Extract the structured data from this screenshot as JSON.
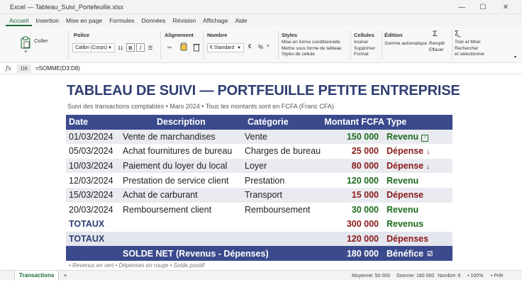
{
  "window": {
    "title": "Excel — Tableau_Suivi_Portefeuille.xlsx",
    "minimize": "—",
    "maximize": "☐",
    "close": "✕"
  },
  "menu": {
    "tabs": [
      "Accueil",
      "Insertion",
      "Mise en page",
      "Formules",
      "Données",
      "Révision",
      "Affichage",
      "Aide"
    ],
    "active_index": 0
  },
  "ribbon": {
    "paste_label": "Coller",
    "font_group": "Police",
    "font_name": "Calibri (Corps)",
    "font_size": "11",
    "bold": "B",
    "italic": "I",
    "underline": "☰",
    "alignment_group": "Alignement",
    "number_group": "Nombre",
    "number_format": "€ Standard",
    "percent": "%",
    "styles_group": "Styles",
    "styles_items": [
      "Mise en forme conditionnelle",
      "Mettre sous forme de tableau",
      "Styles de cellule"
    ],
    "cells_group": "Cellules",
    "cells_items": [
      "Insérer",
      "Supprimer",
      "Format"
    ],
    "editing_group": "Édition",
    "editing_items": [
      "Somme automatique",
      "Remplir",
      "Effacer"
    ],
    "sort_items": [
      "Trier et filtrer",
      "Rechercher",
      "et sélectionner"
    ]
  },
  "formula_bar": {
    "fx": "fx",
    "cell_ref": "D9",
    "formula": "=SOMME(D3:D8)"
  },
  "sheet": {
    "title": "TABLEAU DE SUIVI — PORTFEUILLE PETITE ENTREPRISE",
    "subtitle": "Suivi des transactions comptables • Mars 2024 • Tous les montants sont en FCFA (Franc CFA)",
    "headers": [
      "Date",
      "Description",
      "Catégorie",
      "Montant FCFA",
      "Type"
    ],
    "rows": [
      {
        "date": "01/03/2024",
        "description": "Vente de marchandises",
        "category": "Vente",
        "amount": "150 000",
        "type": "Revenu",
        "kind": "revenue",
        "icon": "↑"
      },
      {
        "date": "05/03/2024",
        "description": "Achat fournitures de bureau",
        "category": "Charges de bureau",
        "amount": "25 000",
        "type": "Dépense",
        "kind": "expense",
        "icon": "↓"
      },
      {
        "date": "10/03/2024",
        "description": "Paiement du loyer du local",
        "category": "Loyer",
        "amount": "80 000",
        "type": "Dépense",
        "kind": "expense",
        "icon": "↓"
      },
      {
        "date": "12/03/2024",
        "description": "Prestation de service client",
        "category": "Prestation",
        "amount": "120 000",
        "type": "Revenu",
        "kind": "revenue",
        "icon": ""
      },
      {
        "date": "15/03/2024",
        "description": "Achat de carburant",
        "category": "Transport",
        "amount": "15 000",
        "type": "Dépense",
        "kind": "expense",
        "icon": ""
      },
      {
        "date": "20/03/2024",
        "description": "Remboursement client",
        "category": "Remboursement",
        "amount": "30 000",
        "type": "Revenu",
        "kind": "revenue",
        "icon": ""
      }
    ],
    "totals": [
      {
        "label": "TOTAUX",
        "amount": "300 000",
        "type": "Revenus",
        "kind": "revenue"
      },
      {
        "label": "TOTAUX",
        "amount": "120 000",
        "type": "Dépenses",
        "kind": "expense"
      }
    ],
    "net": {
      "label": "SOLDE NET (Revenus - Dépenses)",
      "amount": "180 000",
      "type": "Bénéfice",
      "icon": "☑"
    },
    "note": "• Revenus en vert • Dépenses en rouge • Solde positif"
  },
  "status": {
    "sheet_tab": "Transactions",
    "add_tab": "+",
    "average": "Moyenne: 50 000",
    "sum": "Somme: 180 000",
    "count": "Nombre: 6",
    "zoom": "• 100%",
    "ready": "• Prêt"
  },
  "colors": {
    "header_bg": "#3a4a8c",
    "title": "#2f3e73",
    "revenue": "#1e6b1e",
    "expense": "#8b1a1a",
    "accent": "#1e6b3a"
  }
}
